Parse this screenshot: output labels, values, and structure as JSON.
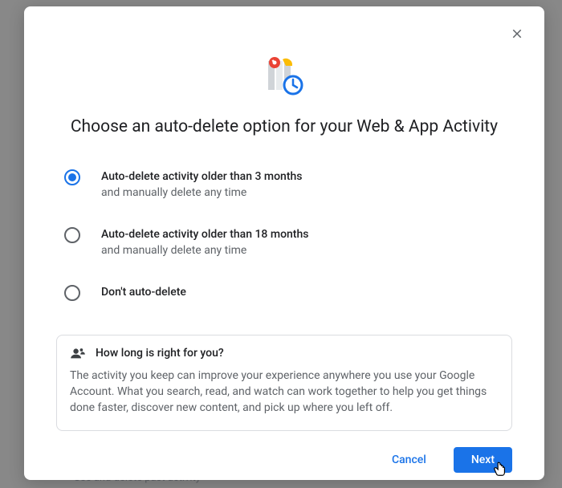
{
  "dialog": {
    "title": "Choose an auto-delete option for your Web & App Activity",
    "options": [
      {
        "label": "Auto-delete activity older than 3 months",
        "sub": "and manually delete any time",
        "selected": true
      },
      {
        "label": "Auto-delete activity older than 18 months",
        "sub": "and manually delete any time",
        "selected": false
      },
      {
        "label": "Don't auto-delete",
        "sub": "",
        "selected": false
      }
    ],
    "info": {
      "title": "How long is right for you?",
      "body": "The activity you keep can improve your experience anywhere you use your Google Account. What you search, read, and watch can work together to help you get things done faster, discover new content, and pick up where you left off."
    },
    "actions": {
      "cancel": "Cancel",
      "next": "Next"
    }
  },
  "backdrop": {
    "link": "See and delete past activity"
  }
}
